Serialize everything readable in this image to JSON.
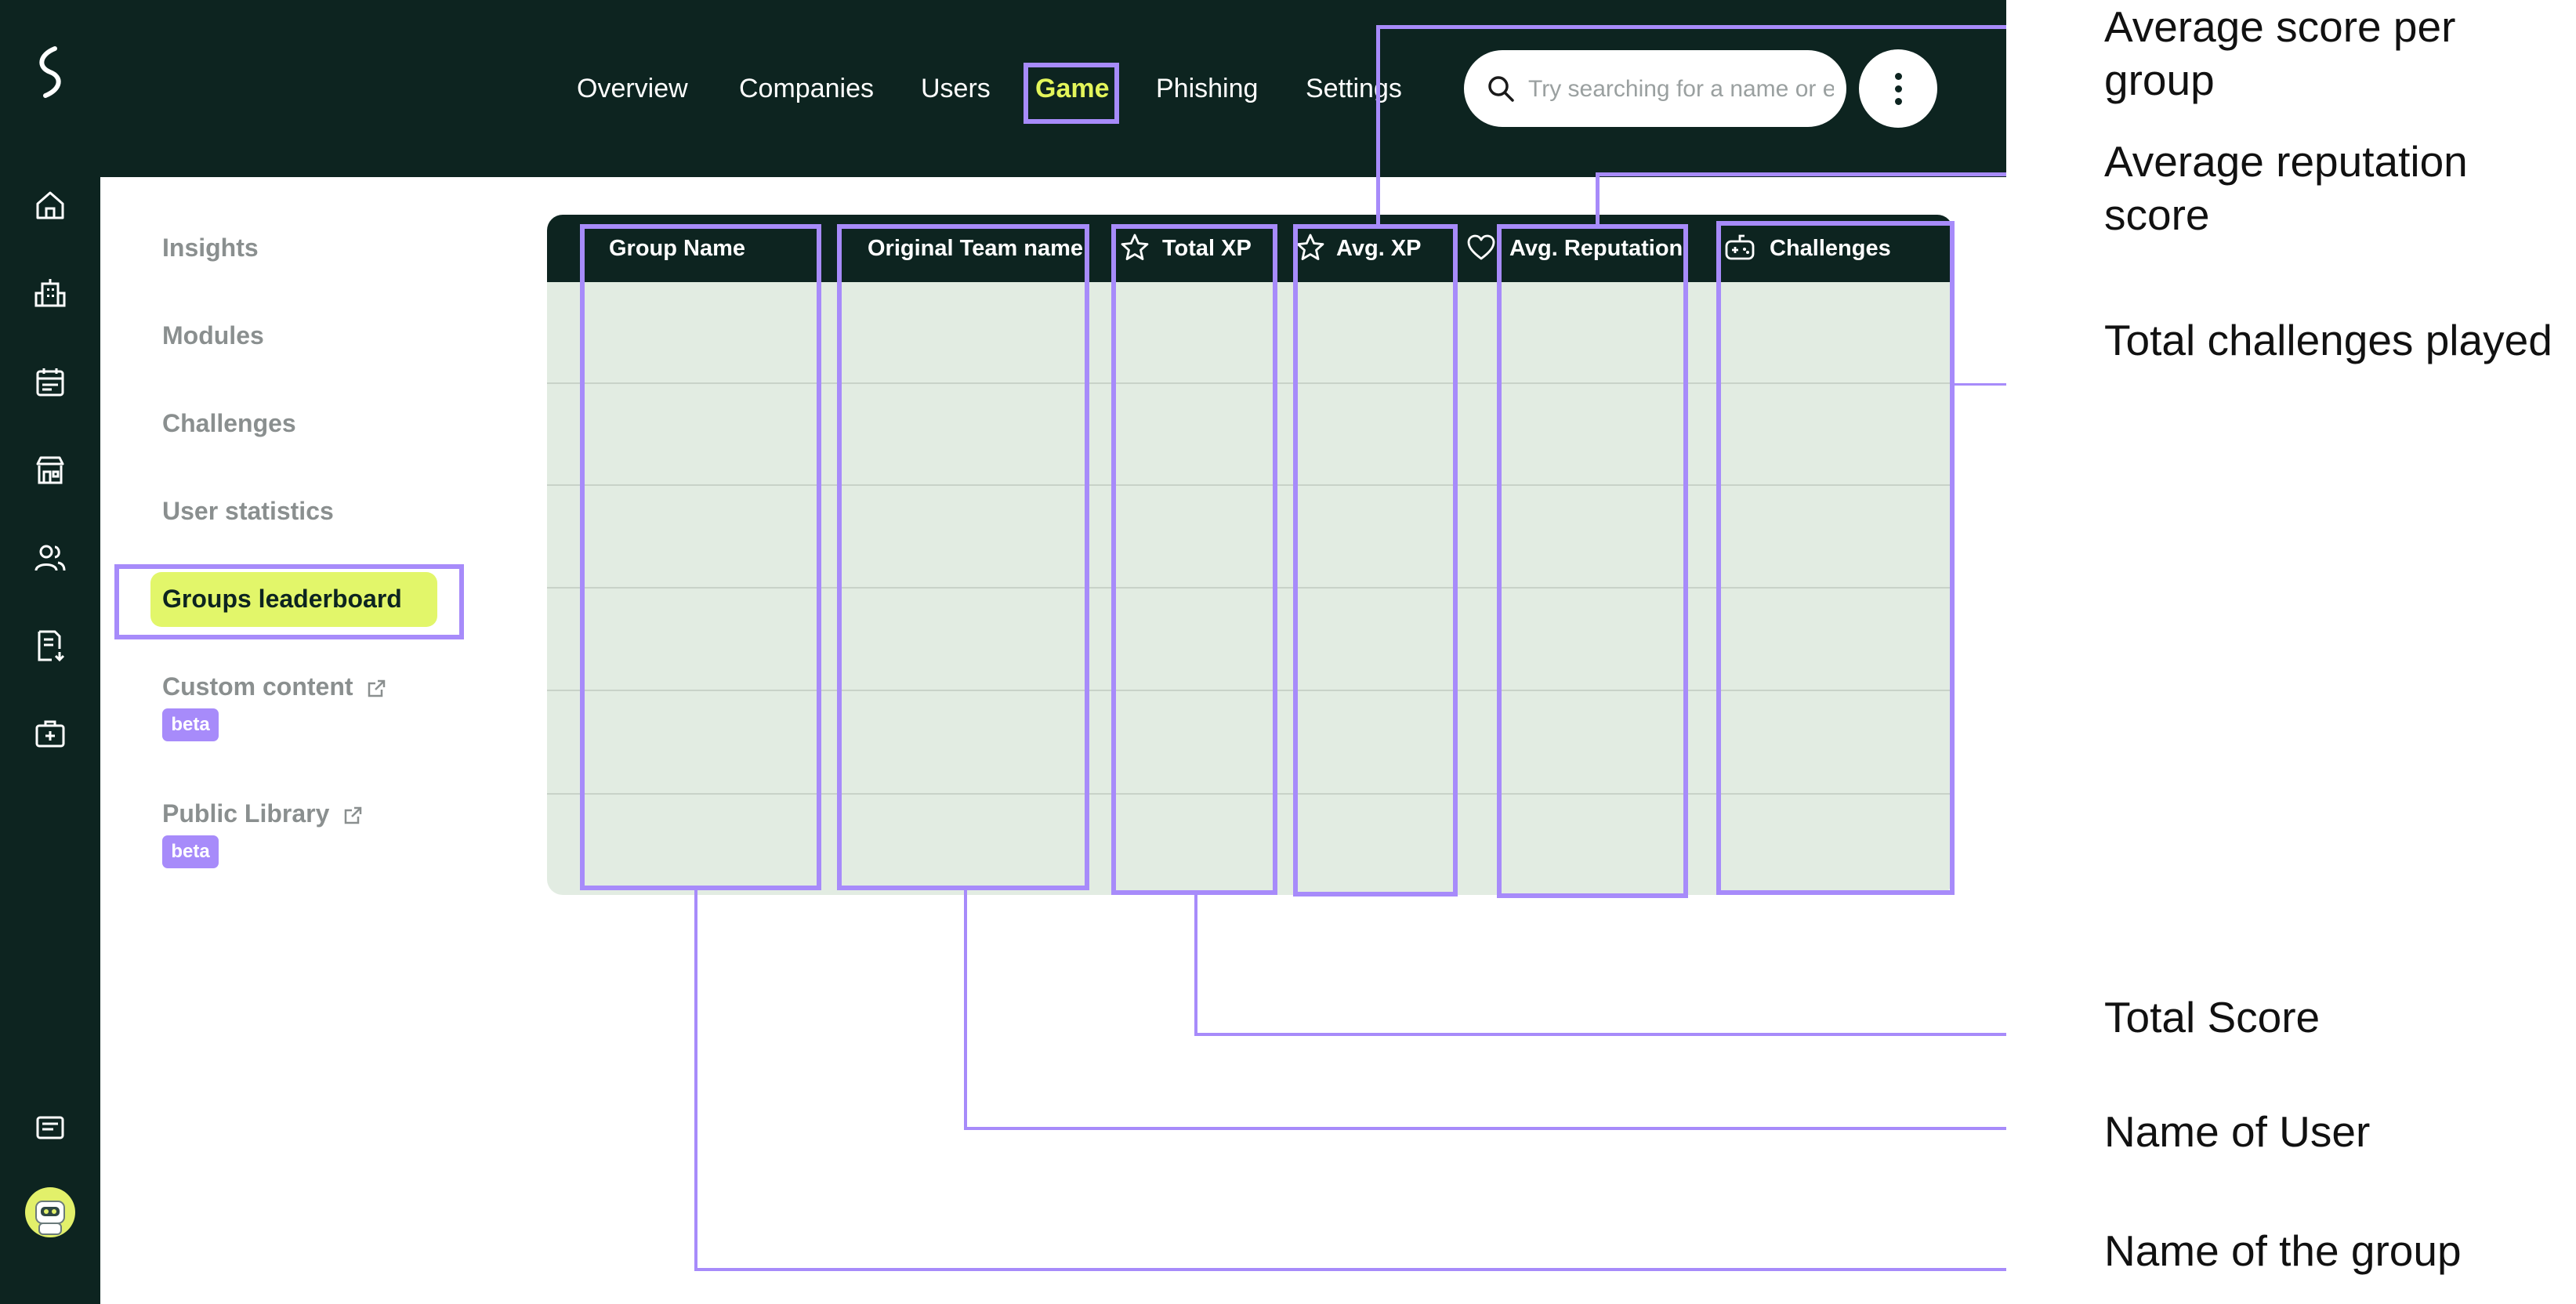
{
  "colors": {
    "dark": "#0d2420",
    "accent": "#e3f55a",
    "annotation": "#a78bfa",
    "table_bg": "#e2ece2",
    "muted_text": "#8a8f8f"
  },
  "rail": {
    "logo_icon": "brand-logo-icon",
    "icons": [
      "home-icon",
      "buildings-icon",
      "calendar-icon",
      "store-icon",
      "users-icon",
      "document-download-icon",
      "first-aid-kit-icon"
    ],
    "bottom_icons": [
      "chat-icon",
      "avatar"
    ]
  },
  "topnav": {
    "items": [
      {
        "label": "Overview",
        "active": false
      },
      {
        "label": "Companies",
        "active": false
      },
      {
        "label": "Users",
        "active": false
      },
      {
        "label": "Game",
        "active": true
      },
      {
        "label": "Phishing",
        "active": false
      },
      {
        "label": "Settings",
        "active": false
      }
    ],
    "search_placeholder": "Try searching for a name or e",
    "more_icon": "kebab-menu-icon"
  },
  "sidebar": {
    "items": [
      {
        "label": "Insights",
        "active": false
      },
      {
        "label": "Modules",
        "active": false
      },
      {
        "label": "Challenges",
        "active": false
      },
      {
        "label": "User statistics",
        "active": false
      },
      {
        "label": "Groups leaderboard",
        "active": true
      },
      {
        "label": "Custom content",
        "external": true,
        "badge": "beta"
      },
      {
        "label": "Public Library",
        "external": true,
        "badge": "beta"
      }
    ]
  },
  "table": {
    "columns": [
      {
        "label": "Group Name",
        "icon": ""
      },
      {
        "label": "Original Team name",
        "icon": ""
      },
      {
        "label": "Total XP",
        "icon": "star-icon"
      },
      {
        "label": "Avg. XP",
        "icon": "star-icon"
      },
      {
        "label": "Avg. Reputation",
        "icon": "heart-icon"
      },
      {
        "label": "Challenges",
        "icon": "game-controller-icon"
      }
    ],
    "row_count": 6
  },
  "annotations": {
    "avg_xp": "Average score per\ngroup",
    "avg_reputation": "Average reputation\nscore",
    "challenges": "Total challenges played",
    "total_xp": "Total Score",
    "team_name": "Name of User",
    "group_name": "Name of the group"
  }
}
